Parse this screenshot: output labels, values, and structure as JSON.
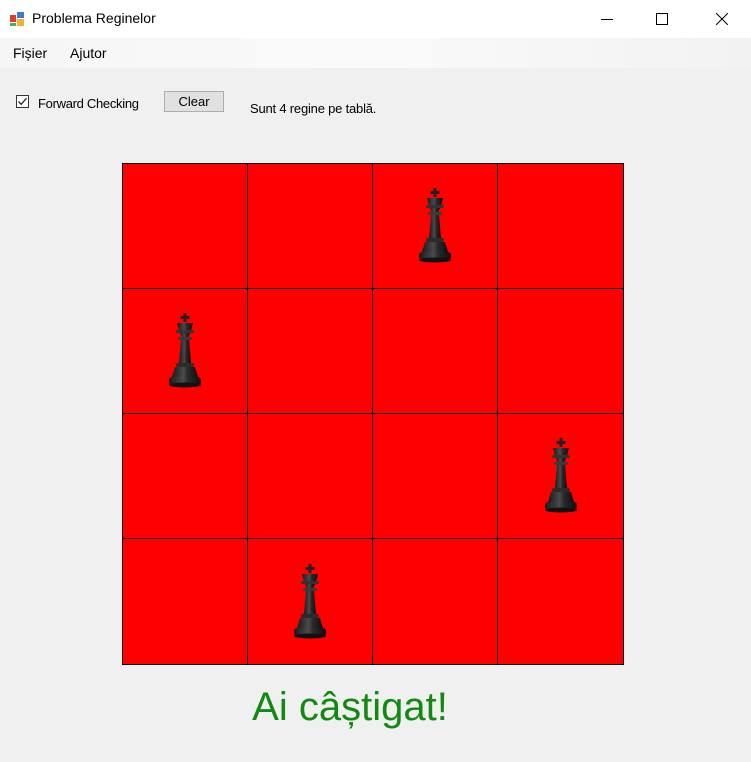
{
  "window": {
    "title": "Problema Reginelor",
    "icon": "app-icon",
    "controls": [
      "minimize-icon",
      "maximize-icon",
      "close-icon"
    ]
  },
  "menu": {
    "items": [
      "Fișier",
      "Ajutor"
    ]
  },
  "toolbar": {
    "forward_checking_label": "Forward Checking",
    "forward_checking_checked": true,
    "clear_label": "Clear",
    "status": "Sunt 4 regine pe tablă."
  },
  "board": {
    "size": 4,
    "cell_color": "#ff0000",
    "grid_color": "#000000",
    "queen_icon": "chess-queen-icon",
    "queens": [
      {
        "row": 0,
        "col": 2
      },
      {
        "row": 1,
        "col": 0
      },
      {
        "row": 2,
        "col": 3
      },
      {
        "row": 3,
        "col": 1
      }
    ]
  },
  "result": {
    "message": "Ai câștigat!",
    "color": "#118a11"
  }
}
